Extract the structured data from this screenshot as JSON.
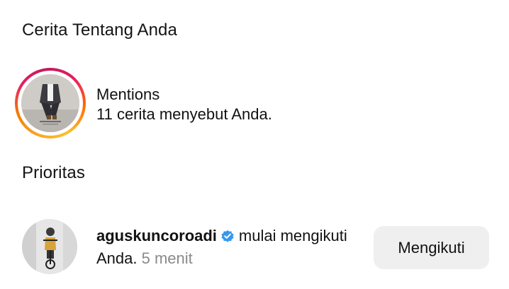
{
  "sections": {
    "stories_about_you": "Cerita Tentang Anda",
    "priority": "Prioritas"
  },
  "mentions": {
    "title": "Mentions",
    "subtitle": "11 cerita menyebut Anda."
  },
  "notification": {
    "username": "aguskuncoroadi",
    "verified": true,
    "action": "mulai mengikuti",
    "action_cont": "Anda.",
    "time": "5 menit",
    "button_label": "Mengikuti"
  },
  "colors": {
    "verified_badge": "#3897f0",
    "button_bg": "#efefef",
    "time_text": "#8a8a8a"
  },
  "icons": {
    "verified": "verified-badge-icon"
  }
}
